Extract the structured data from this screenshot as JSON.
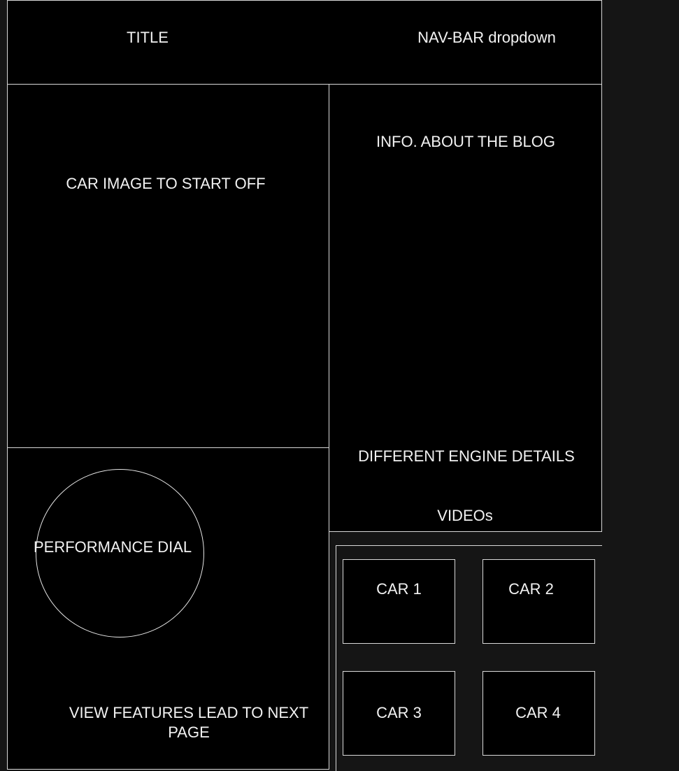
{
  "header": {
    "title": "TITLE",
    "nav": "NAV-BAR dropdown"
  },
  "hero": {
    "label": "CAR IMAGE TO START OFF"
  },
  "info": {
    "label": "INFO. ABOUT THE BLOG",
    "engine_label": "DIFFERENT ENGINE DETAILS",
    "videos_label": "VIDEOs"
  },
  "performance": {
    "dial_label": "PERFORMANCE DIAL",
    "cta_line1": "VIEW FEATURES LEAD TO NEXT",
    "cta_line2": "PAGE"
  },
  "cars": [
    {
      "label": "CAR 1"
    },
    {
      "label": "CAR 2"
    },
    {
      "label": "CAR 3"
    },
    {
      "label": "CAR 4"
    }
  ],
  "colors": {
    "background": "#151515",
    "panel": "#000000",
    "stroke": "#d9d9d9",
    "text": "#f2f2f2"
  }
}
